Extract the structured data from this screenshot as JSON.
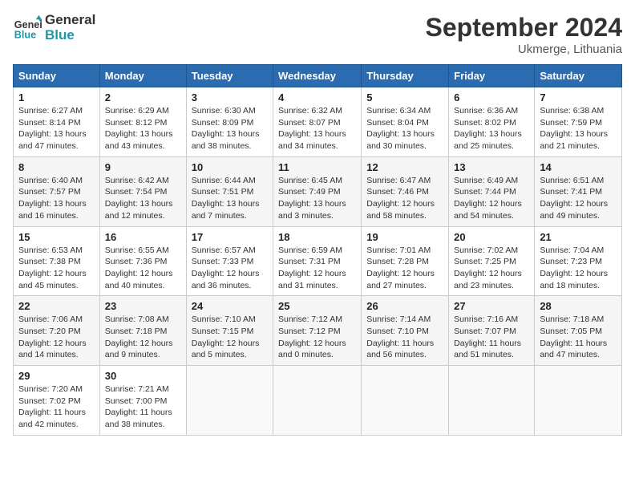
{
  "header": {
    "logo_line1": "General",
    "logo_line2": "Blue",
    "month": "September 2024",
    "location": "Ukmerge, Lithuania"
  },
  "columns": [
    "Sunday",
    "Monday",
    "Tuesday",
    "Wednesday",
    "Thursday",
    "Friday",
    "Saturday"
  ],
  "weeks": [
    [
      {
        "day": "1",
        "detail": "Sunrise: 6:27 AM\nSunset: 8:14 PM\nDaylight: 13 hours\nand 47 minutes."
      },
      {
        "day": "2",
        "detail": "Sunrise: 6:29 AM\nSunset: 8:12 PM\nDaylight: 13 hours\nand 43 minutes."
      },
      {
        "day": "3",
        "detail": "Sunrise: 6:30 AM\nSunset: 8:09 PM\nDaylight: 13 hours\nand 38 minutes."
      },
      {
        "day": "4",
        "detail": "Sunrise: 6:32 AM\nSunset: 8:07 PM\nDaylight: 13 hours\nand 34 minutes."
      },
      {
        "day": "5",
        "detail": "Sunrise: 6:34 AM\nSunset: 8:04 PM\nDaylight: 13 hours\nand 30 minutes."
      },
      {
        "day": "6",
        "detail": "Sunrise: 6:36 AM\nSunset: 8:02 PM\nDaylight: 13 hours\nand 25 minutes."
      },
      {
        "day": "7",
        "detail": "Sunrise: 6:38 AM\nSunset: 7:59 PM\nDaylight: 13 hours\nand 21 minutes."
      }
    ],
    [
      {
        "day": "8",
        "detail": "Sunrise: 6:40 AM\nSunset: 7:57 PM\nDaylight: 13 hours\nand 16 minutes."
      },
      {
        "day": "9",
        "detail": "Sunrise: 6:42 AM\nSunset: 7:54 PM\nDaylight: 13 hours\nand 12 minutes."
      },
      {
        "day": "10",
        "detail": "Sunrise: 6:44 AM\nSunset: 7:51 PM\nDaylight: 13 hours\nand 7 minutes."
      },
      {
        "day": "11",
        "detail": "Sunrise: 6:45 AM\nSunset: 7:49 PM\nDaylight: 13 hours\nand 3 minutes."
      },
      {
        "day": "12",
        "detail": "Sunrise: 6:47 AM\nSunset: 7:46 PM\nDaylight: 12 hours\nand 58 minutes."
      },
      {
        "day": "13",
        "detail": "Sunrise: 6:49 AM\nSunset: 7:44 PM\nDaylight: 12 hours\nand 54 minutes."
      },
      {
        "day": "14",
        "detail": "Sunrise: 6:51 AM\nSunset: 7:41 PM\nDaylight: 12 hours\nand 49 minutes."
      }
    ],
    [
      {
        "day": "15",
        "detail": "Sunrise: 6:53 AM\nSunset: 7:38 PM\nDaylight: 12 hours\nand 45 minutes."
      },
      {
        "day": "16",
        "detail": "Sunrise: 6:55 AM\nSunset: 7:36 PM\nDaylight: 12 hours\nand 40 minutes."
      },
      {
        "day": "17",
        "detail": "Sunrise: 6:57 AM\nSunset: 7:33 PM\nDaylight: 12 hours\nand 36 minutes."
      },
      {
        "day": "18",
        "detail": "Sunrise: 6:59 AM\nSunset: 7:31 PM\nDaylight: 12 hours\nand 31 minutes."
      },
      {
        "day": "19",
        "detail": "Sunrise: 7:01 AM\nSunset: 7:28 PM\nDaylight: 12 hours\nand 27 minutes."
      },
      {
        "day": "20",
        "detail": "Sunrise: 7:02 AM\nSunset: 7:25 PM\nDaylight: 12 hours\nand 23 minutes."
      },
      {
        "day": "21",
        "detail": "Sunrise: 7:04 AM\nSunset: 7:23 PM\nDaylight: 12 hours\nand 18 minutes."
      }
    ],
    [
      {
        "day": "22",
        "detail": "Sunrise: 7:06 AM\nSunset: 7:20 PM\nDaylight: 12 hours\nand 14 minutes."
      },
      {
        "day": "23",
        "detail": "Sunrise: 7:08 AM\nSunset: 7:18 PM\nDaylight: 12 hours\nand 9 minutes."
      },
      {
        "day": "24",
        "detail": "Sunrise: 7:10 AM\nSunset: 7:15 PM\nDaylight: 12 hours\nand 5 minutes."
      },
      {
        "day": "25",
        "detail": "Sunrise: 7:12 AM\nSunset: 7:12 PM\nDaylight: 12 hours\nand 0 minutes."
      },
      {
        "day": "26",
        "detail": "Sunrise: 7:14 AM\nSunset: 7:10 PM\nDaylight: 11 hours\nand 56 minutes."
      },
      {
        "day": "27",
        "detail": "Sunrise: 7:16 AM\nSunset: 7:07 PM\nDaylight: 11 hours\nand 51 minutes."
      },
      {
        "day": "28",
        "detail": "Sunrise: 7:18 AM\nSunset: 7:05 PM\nDaylight: 11 hours\nand 47 minutes."
      }
    ],
    [
      {
        "day": "29",
        "detail": "Sunrise: 7:20 AM\nSunset: 7:02 PM\nDaylight: 11 hours\nand 42 minutes."
      },
      {
        "day": "30",
        "detail": "Sunrise: 7:21 AM\nSunset: 7:00 PM\nDaylight: 11 hours\nand 38 minutes."
      },
      null,
      null,
      null,
      null,
      null
    ]
  ]
}
